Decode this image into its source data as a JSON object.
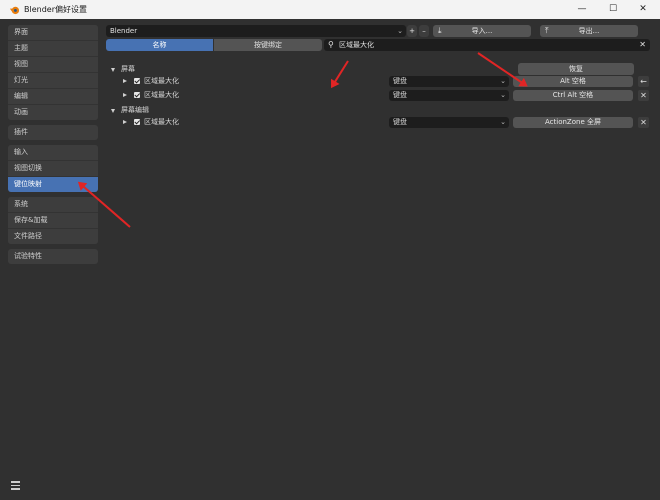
{
  "window": {
    "title": "Blender偏好设置",
    "controls": [
      "minimize-icon",
      "maximize-icon",
      "close-icon"
    ]
  },
  "sidebar": {
    "groups": [
      {
        "items": [
          {
            "label": "界面"
          },
          {
            "label": "主题"
          },
          {
            "label": "视图"
          },
          {
            "label": "灯光"
          },
          {
            "label": "编辑"
          },
          {
            "label": "动画"
          }
        ]
      },
      {
        "items": [
          {
            "label": "插件"
          }
        ]
      },
      {
        "items": [
          {
            "label": "输入"
          },
          {
            "label": "视图切换"
          },
          {
            "label": "键位映射",
            "active": true
          }
        ]
      },
      {
        "items": [
          {
            "label": "系统"
          },
          {
            "label": "保存&加载"
          },
          {
            "label": "文件路径"
          }
        ]
      },
      {
        "items": [
          {
            "label": "试验特性"
          }
        ]
      }
    ]
  },
  "keymap": {
    "preset": "Blender",
    "import_label": "导入...",
    "export_label": "导出...",
    "tab_name": "名称",
    "tab_key": "按键绑定",
    "search_value": "区域最大化",
    "restore_label": "恢复"
  },
  "tree": {
    "screen_label": "屏幕",
    "screen_edit_label": "屏幕编辑",
    "rows": [
      {
        "label": "区域最大化",
        "device": "键盘",
        "binding": "Alt 空格"
      },
      {
        "label": "区域最大化",
        "device": "键盘",
        "binding": "Ctrl Alt 空格"
      },
      {
        "label": "区域最大化",
        "device": "键盘",
        "binding": "ActionZone 全屏"
      }
    ]
  }
}
